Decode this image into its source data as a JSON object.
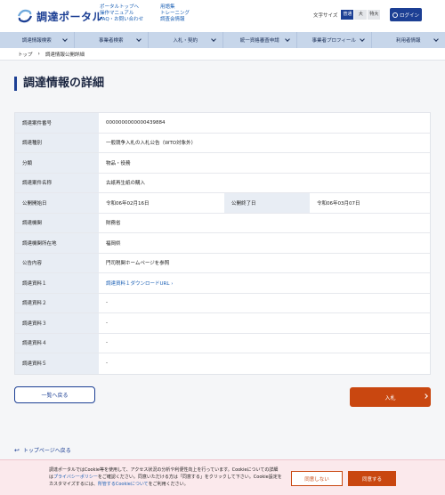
{
  "header": {
    "logo_text": "調達ポータル",
    "links_col1": [
      "ポータルトップへ",
      "操作マニュアル",
      "FAQ・お問い合わせ"
    ],
    "links_col2": [
      "用語集",
      "トレーニング",
      "調査会情報"
    ],
    "font_size_label": "文字サイズ",
    "font_sizes": [
      "普通",
      "大",
      "特大"
    ],
    "login_label": "ログイン"
  },
  "nav": {
    "items": [
      "調達情報検索",
      "事業者検索",
      "入札・契約",
      "統一資格審査申請",
      "事業者プロフィール",
      "利用者情報"
    ]
  },
  "breadcrumb": {
    "home": "トップ",
    "current": "調達情報公開詳細"
  },
  "page_title": "調達情報の詳細",
  "detail": {
    "case_number": {
      "label": "調達案件番号",
      "value": "0000000000000439884"
    },
    "type": {
      "label": "調達種別",
      "value": "一般競争入札の入札公告（WTO対象外）"
    },
    "category": {
      "label": "分類",
      "value": "物品・役務"
    },
    "case_name": {
      "label": "調達案件名称",
      "value": "古紙再生紙の購入"
    },
    "start_date": {
      "label": "公開開始日",
      "value": "令和06年02月16日"
    },
    "end_date": {
      "label": "公開終了日",
      "value": "令和06年03月07日"
    },
    "agency": {
      "label": "調達機関",
      "value": "財務省"
    },
    "location": {
      "label": "調達機関所在地",
      "value": "福岡県"
    },
    "content": {
      "label": "公告内容",
      "value": "門司税関ホームページを参照"
    },
    "doc1": {
      "label": "調達資料１",
      "value": "調達資料１ダウンロードURL"
    },
    "doc2": {
      "label": "調達資料２",
      "value": "-"
    },
    "doc3": {
      "label": "調達資料３",
      "value": "-"
    },
    "doc4": {
      "label": "調達資料４",
      "value": "-"
    },
    "doc5": {
      "label": "調達資料５",
      "value": "-"
    }
  },
  "buttons": {
    "back": "一覧へ戻る",
    "bid": "入札",
    "top_link": "トップページへ戻る"
  },
  "cookie": {
    "text_1": "調達ポータルではCookie等を使用して、アクセス状況の分析や利便性向上を行っています。Cookieについての詳細は",
    "privacy_link": "プライバシーポリシー",
    "text_2": "をご確認ください。同意いただける方は「同意する」をクリックして下さい。Cookie設定をカスタマイズするには、",
    "cookie_link": "所管するCookieについて",
    "text_3": "をご利用ください。",
    "decline": "同意しない",
    "accept": "同意する"
  },
  "colors": {
    "brand": "#1c3f94",
    "accent": "#c94710",
    "nav_bg": "#c7d6ea"
  }
}
